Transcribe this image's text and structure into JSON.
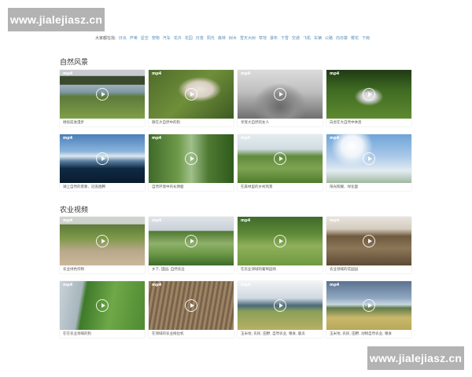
{
  "watermarks": {
    "top": "www.jialejiasz.cn",
    "bottom": "www.jialejiasz.cn"
  },
  "tag_bar": {
    "label": "大家都在找:",
    "tags": [
      "日出",
      "芦苇",
      "星空",
      "宠物",
      "汽车",
      "花卉",
      "花园",
      "日落",
      "阳光",
      "森林",
      "树木",
      "雪天大树",
      "草地",
      "瀑布",
      "下雪",
      "交通",
      "飞机",
      "车辆",
      "公路",
      "向日葵",
      "樱花",
      "下雨"
    ]
  },
  "sections": [
    {
      "title": "自然风景",
      "cards": [
        {
          "badge": "mp4",
          "caption": "继续前进漫步"
        },
        {
          "badge": "mp4",
          "caption": "跑在大自然中的狗"
        },
        {
          "badge": "mp4",
          "caption": "享受大自然的女人"
        },
        {
          "badge": "mp4",
          "caption": "白虎在大自然中休息"
        },
        {
          "badge": "mp4",
          "caption": "湖上自然的景象、冠盖图腾"
        },
        {
          "badge": "mp4",
          "caption": "自然环境中的长颈鹿"
        },
        {
          "badge": "mp4",
          "caption": "在森林里的乡村风景"
        },
        {
          "badge": "mp4",
          "caption": "阳光照耀、绿化面"
        }
      ]
    },
    {
      "title": "农业视频",
      "cards": [
        {
          "badge": "mp4",
          "caption": "农业绿色作物"
        },
        {
          "badge": "mp4",
          "caption": "乡下, 田园, 自然农业"
        },
        {
          "badge": "mp4",
          "caption": "在农业领域的葡萄园场"
        },
        {
          "badge": "mp4",
          "caption": "农业领域的花园园"
        },
        {
          "badge": "mp4",
          "caption": "在在农业领域的狗"
        },
        {
          "badge": "mp4",
          "caption": "在领域的农业拖拉机"
        },
        {
          "badge": "mp4",
          "caption": "玉米地, 农民, 田野, 自然农业, 粮食, 鹿瓜"
        },
        {
          "badge": "mp4",
          "caption": "玉米地, 农民, 田野, 动物自然农业, 粮食"
        }
      ]
    }
  ]
}
